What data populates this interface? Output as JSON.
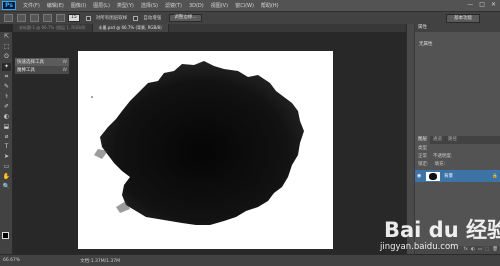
{
  "app": {
    "logo": "Ps"
  },
  "menu": [
    "文件(F)",
    "编辑(E)",
    "图像(I)",
    "图层(L)",
    "类型(Y)",
    "选择(S)",
    "滤镜(T)",
    "3D(D)",
    "视图(V)",
    "窗口(W)",
    "帮助(H)"
  ],
  "window_controls": [
    "—",
    "□",
    "✕"
  ],
  "options": {
    "brush_size_label": "15",
    "sample_label": "对所有图层取样",
    "auto_enhance_label": "自动增强",
    "refine_edge": "调整边缘...",
    "workspace": "基本功能"
  },
  "doc_tabs": [
    {
      "label": "未标题-1 @ 66.7% (图层 1, RGB/8)",
      "active": false
    },
    {
      "label": "水墨.psd @ 66.7% (背景, RGB/8)",
      "active": true
    }
  ],
  "tools": [
    "⇱",
    "⬚",
    "ʘ",
    "✦",
    "⌗",
    "✎",
    "⚕",
    "✐",
    "◐",
    "⬓",
    "⌀",
    "T",
    "➤",
    "▭",
    "✋",
    "🔍"
  ],
  "tool_popup": [
    {
      "label": "快速选择工具",
      "key": "W",
      "selected": true
    },
    {
      "label": "魔棒工具",
      "key": "W",
      "selected": false
    }
  ],
  "properties_panel": {
    "tab": "属性",
    "label": "无属性"
  },
  "layers_panel": {
    "tabs": [
      "图层",
      "通道",
      "路径"
    ],
    "kind_row": "类型",
    "blend_row": "正常",
    "opacity_label": "不透明度:",
    "lock_label": "锁定:",
    "fill_label": "填充:",
    "layer_name": "背景",
    "footer_icons": [
      "fx",
      "◐",
      "▭",
      "⬚",
      "🗑"
    ]
  },
  "status": {
    "zoom": "66.67%",
    "doc_size": "文档:1.37M/1.37M"
  },
  "watermark": {
    "logo": "Bai du 经验",
    "url": "jingyan.baidu.com"
  }
}
